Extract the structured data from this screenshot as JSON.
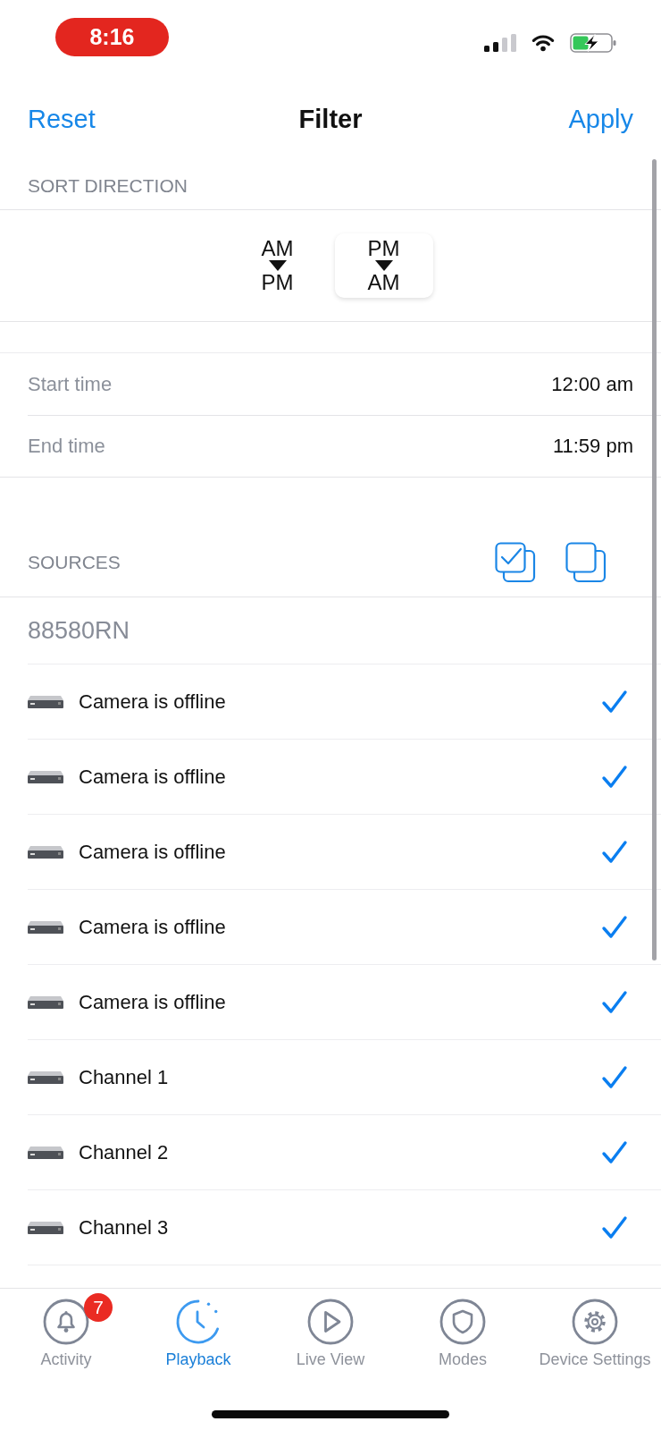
{
  "status_bar": {
    "time": "8:16"
  },
  "nav_bar": {
    "left_button": "Reset",
    "title": "Filter",
    "right_button": "Apply"
  },
  "sort_direction": {
    "header": "SORT DIRECTION",
    "options": [
      {
        "from": "AM",
        "to": "PM",
        "selected": false
      },
      {
        "from": "PM",
        "to": "AM",
        "selected": true
      }
    ]
  },
  "time_range": [
    {
      "label": "Start time",
      "value": "12:00 am"
    },
    {
      "label": "End time",
      "value": "11:59 pm"
    }
  ],
  "sources": {
    "header": "SOURCES",
    "device": "88580RN",
    "items": [
      {
        "name": "Camera is offline",
        "checked": true
      },
      {
        "name": "Camera is offline",
        "checked": true
      },
      {
        "name": "Camera is offline",
        "checked": true
      },
      {
        "name": "Camera is offline",
        "checked": true
      },
      {
        "name": "Camera is offline",
        "checked": true
      },
      {
        "name": "Channel 1",
        "checked": true
      },
      {
        "name": "Channel 2",
        "checked": true
      },
      {
        "name": "Channel 3",
        "checked": true
      }
    ]
  },
  "tab_bar": [
    {
      "kind": "bell",
      "label": "Activity",
      "badge": "7",
      "selected": false
    },
    {
      "kind": "clock",
      "label": "Playback",
      "selected": true
    },
    {
      "kind": "play",
      "label": "Live View",
      "selected": false
    },
    {
      "kind": "shield",
      "label": "Modes",
      "selected": false
    },
    {
      "kind": "gear",
      "label": "Device Settings",
      "selected": false
    }
  ]
}
